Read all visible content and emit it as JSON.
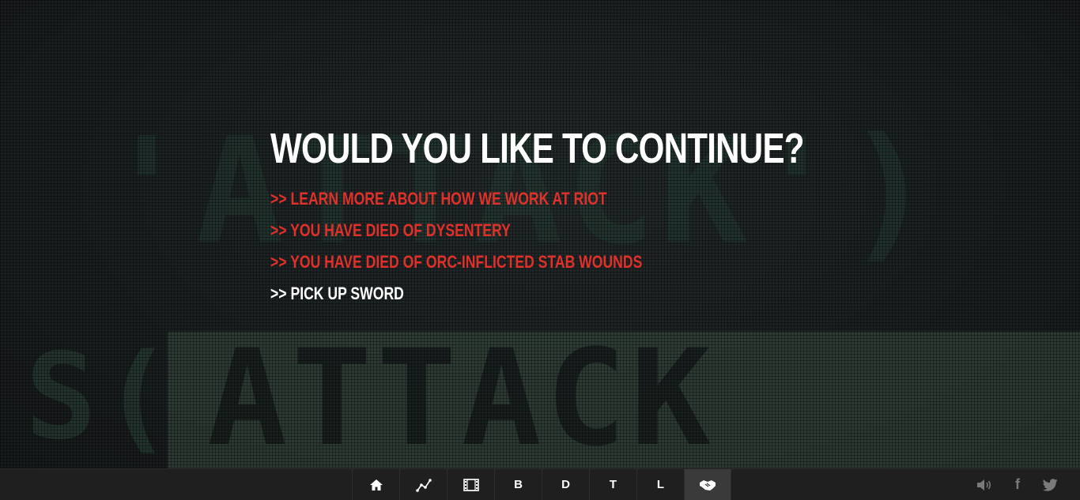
{
  "background": {
    "upper_word": "'ATTACK')",
    "lower_word": "ATTACK",
    "lower_left_fragment": "S("
  },
  "main": {
    "headline": "WOULD YOU LIKE TO CONTINUE?",
    "options": [
      {
        "prefix": ">>",
        "label": "LEARN MORE ABOUT HOW WE WORK AT RIOT",
        "color": "#e0302a"
      },
      {
        "prefix": ">>",
        "label": "YOU HAVE DIED OF DYSENTERY",
        "color": "#e0302a"
      },
      {
        "prefix": ">>",
        "label": "YOU HAVE DIED OF ORC-INFLICTED STAB WOUNDS",
        "color": "#e0302a"
      },
      {
        "prefix": ">>",
        "label": "PICK UP SWORD",
        "color": "#ffffff"
      }
    ]
  },
  "footer": {
    "nav": [
      {
        "icon": "home-icon"
      },
      {
        "icon": "graph-icon"
      },
      {
        "icon": "film-icon"
      },
      {
        "label": "B"
      },
      {
        "label": "D"
      },
      {
        "label": "T"
      },
      {
        "label": "L"
      },
      {
        "icon": "handshake-icon",
        "active": true
      }
    ],
    "social": [
      {
        "icon": "volume-icon"
      },
      {
        "icon": "facebook-icon",
        "glyph": "f"
      },
      {
        "icon": "twitter-icon"
      }
    ]
  },
  "colors": {
    "accent_red": "#e0302a",
    "text_white": "#ffffff",
    "footer_bg": "#1f1f1f"
  }
}
